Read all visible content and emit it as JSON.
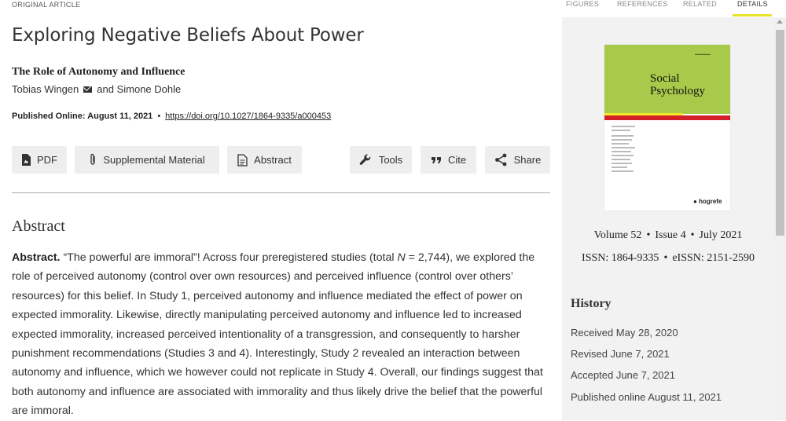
{
  "article": {
    "type_label": "ORIGINAL ARTICLE",
    "title": "Exploring Negative Beliefs About Power",
    "subtitle": "The Role of Autonomy and Influence",
    "author1": "Tobias Wingen",
    "author_sep": "and Simone Dohle",
    "published_label": "Published Online: August 11, 2021",
    "pub_sep": "•",
    "doi": "https://doi.org/10.1027/1864-9335/a000453"
  },
  "actions": {
    "pdf": "PDF",
    "supplemental": "Supplemental Material",
    "abstract": "Abstract",
    "tools": "Tools",
    "cite": "Cite",
    "share": "Share"
  },
  "abstract": {
    "heading": "Abstract",
    "lead": "Abstract.",
    "text_before_n": " “The powerful are immoral”! Across four preregistered studies (total ",
    "n_symbol": "N",
    "text_after_n": " = 2,744), we explored the role of perceived autonomy (control over own resources) and perceived influence (control over others’ resources) for this belief. In Study 1, perceived autonomy and influence mediated the effect of power on expected immorality. Likewise, directly manipulating perceived autonomy and influence led to increased expected immorality, increased perceived intentionality of a transgression, and consequently to harsher punishment recommendations (Studies 3 and 4). Interestingly, Study 2 revealed an interaction between autonomy and influence, which we however could not replicate in Study 4. Overall, our findings suggest that both autonomy and influence are associated with immorality and thus likely drive the belief that the powerful are immoral."
  },
  "tabs": [
    "FIGURES",
    "REFERENCES",
    "RELATED",
    "DETAILS"
  ],
  "journal": {
    "cover_title_1": "Social",
    "cover_title_2": "Psychology",
    "cover_publisher": "hogrefe",
    "volume": "Volume 52",
    "issue": "Issue 4",
    "date": "July 2021",
    "bullet": "•",
    "issn": "ISSN: 1864-9335",
    "eissn": "eISSN: 2151-2590"
  },
  "history": {
    "heading": "History",
    "received": "Received May 28, 2020",
    "revised": "Revised June 7, 2021",
    "accepted": "Accepted June 7, 2021",
    "published": "Published online August 11, 2021"
  },
  "colors": {
    "accent_yellow": "#e5e229",
    "cover_green": "#a8c94a",
    "cover_red": "#d32028",
    "button_bg": "#eeeeee",
    "sidebar_bg": "#f2f2f2"
  }
}
